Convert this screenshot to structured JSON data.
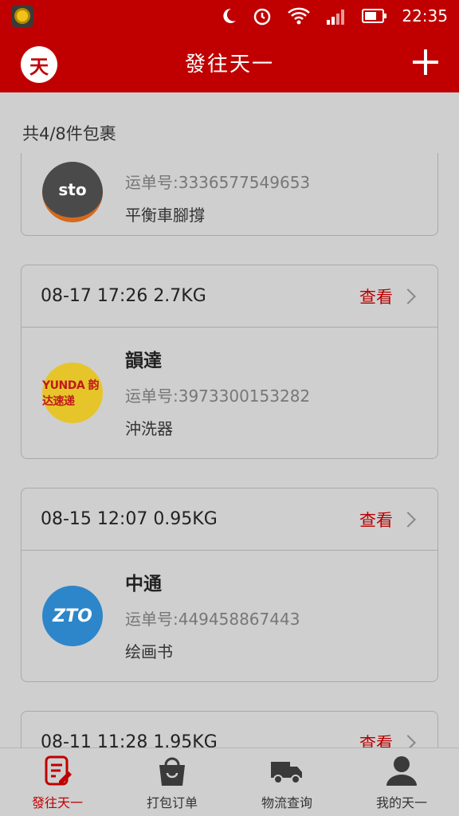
{
  "status_bar": {
    "time": "22:35"
  },
  "header": {
    "title": "發往天一",
    "logo_char": "天"
  },
  "summary": "共4/8件包裹",
  "view_label": "查看",
  "parcels": [
    {
      "datetime_weight": "",
      "carrier": "",
      "logo_text": "sto",
      "tracking": "运单号:3336577549653",
      "item": "平衡車腳撐"
    },
    {
      "datetime_weight": "08-17 17:26 2.7KG",
      "carrier": "韻達",
      "logo_text": "YUNDA 韵达速递",
      "tracking": "运单号:3973300153282",
      "item": "沖洗器"
    },
    {
      "datetime_weight": "08-15 12:07 0.95KG",
      "carrier": "中通",
      "logo_text": "ZTO",
      "tracking": "运单号:449458867443",
      "item": "绘画书"
    },
    {
      "datetime_weight": "08-11 11:28 1.95KG",
      "carrier": "",
      "logo_text": "",
      "tracking": "",
      "item": ""
    }
  ],
  "nav": [
    {
      "label": "發往天一",
      "icon": "order-icon",
      "active": true
    },
    {
      "label": "打包订单",
      "icon": "bag-icon",
      "active": false
    },
    {
      "label": "物流查询",
      "icon": "truck-icon",
      "active": false
    },
    {
      "label": "我的天一",
      "icon": "user-icon",
      "active": false
    }
  ],
  "colors": {
    "brand": "#c00000",
    "overlay_bg": "#cfcfcf"
  }
}
